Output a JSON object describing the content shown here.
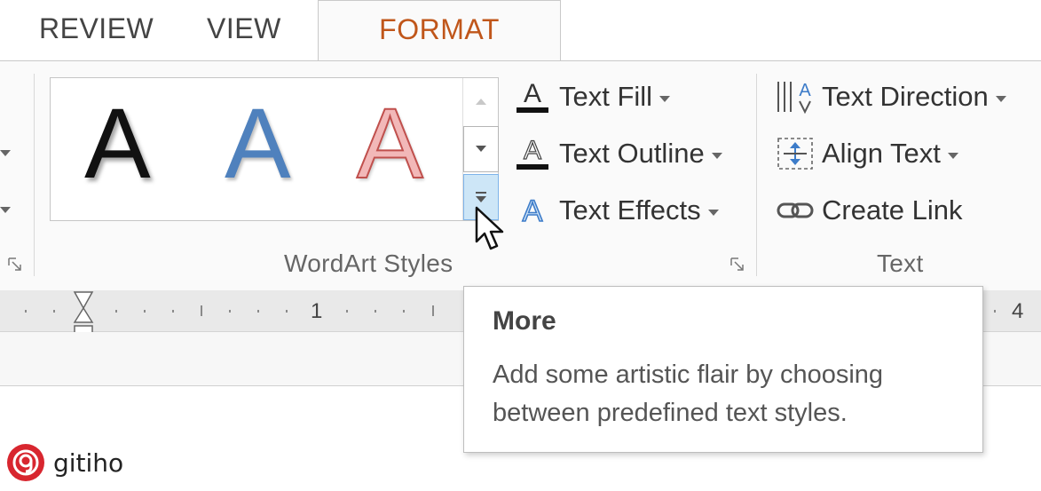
{
  "tabs": [
    {
      "label": "REVIEW",
      "active": false
    },
    {
      "label": "VIEW",
      "active": false
    },
    {
      "label": "FORMAT",
      "active": true
    }
  ],
  "colors": {
    "active_tab_text": "#c0561a",
    "wordart_black": "#111111",
    "wordart_blue": "#4f81bd",
    "wordart_red_fill": "#f2b8b8",
    "wordart_red_outline": "#c0504d",
    "more_button_highlight": "#cde6f7"
  },
  "wordart_styles": {
    "group_label": "WordArt Styles",
    "gallery": [
      {
        "glyph": "A",
        "style": "black-shadow"
      },
      {
        "glyph": "A",
        "style": "blue-fill"
      },
      {
        "glyph": "A",
        "style": "red-outline-fill"
      }
    ],
    "commands": [
      {
        "label": "Text Fill",
        "icon": "text-fill-icon"
      },
      {
        "label": "Text Outline",
        "icon": "text-outline-icon"
      },
      {
        "label": "Text Effects",
        "icon": "text-effects-icon"
      }
    ]
  },
  "text_group": {
    "group_label": "Text",
    "commands": [
      {
        "label": "Text Direction",
        "icon": "text-direction-icon"
      },
      {
        "label": "Align Text",
        "icon": "align-text-icon"
      },
      {
        "label": "Create Link",
        "icon": "create-link-icon"
      }
    ]
  },
  "ruler": {
    "labels": [
      "1",
      "4"
    ]
  },
  "tooltip": {
    "title": "More",
    "body": "Add some artistic flair by choosing between predefined text styles."
  },
  "brand": {
    "name": "gitiho"
  }
}
